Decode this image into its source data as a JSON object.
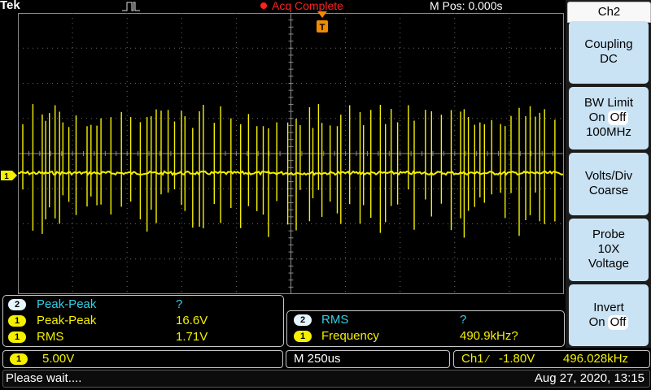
{
  "top": {
    "brand": "Tek",
    "acq_status": "Acq Complete",
    "mpos": "M Pos: 0.000s"
  },
  "colors": {
    "ch1": "#f4f000",
    "ch2": "#33d0e6",
    "acq": "#ff2020",
    "trigger": "#f08a00"
  },
  "markers": {
    "ch1": "1",
    "trigger": "T"
  },
  "measurements_left": [
    {
      "channel": "2",
      "label": "Peak-Peak",
      "value": "?"
    },
    {
      "channel": "1",
      "label": "Peak-Peak",
      "value": "16.6V"
    },
    {
      "channel": "1",
      "label": "RMS",
      "value": "1.71V"
    }
  ],
  "measurements_right": [
    {
      "channel": "2",
      "label": "RMS",
      "value": "?"
    },
    {
      "channel": "1",
      "label": "Frequency",
      "value": "490.9kHz?"
    }
  ],
  "status": {
    "ch1_badge": "1",
    "ch1_scale": "5.00V",
    "timebase": "M 250us",
    "trigger_source": "Ch1",
    "trigger_slope": "⁄",
    "trigger_level": "-1.80V",
    "trigger_freq": "496.028kHz"
  },
  "message": {
    "text": "Please wait....",
    "datetime": "Aug 27, 2020, 13:15"
  },
  "side_menu": {
    "title": "Ch2",
    "coupling_label": "Coupling",
    "coupling_value": "DC",
    "bw_label": "BW Limit",
    "bw_on": "On",
    "bw_off": "Off",
    "bw_value": "100MHz",
    "vdiv_label": "Volts/Div",
    "vdiv_value": "Coarse",
    "probe_label": "Probe",
    "probe_value": "10X",
    "probe_type": "Voltage",
    "invert_label": "Invert",
    "invert_on": "On",
    "invert_off": "Off"
  }
}
